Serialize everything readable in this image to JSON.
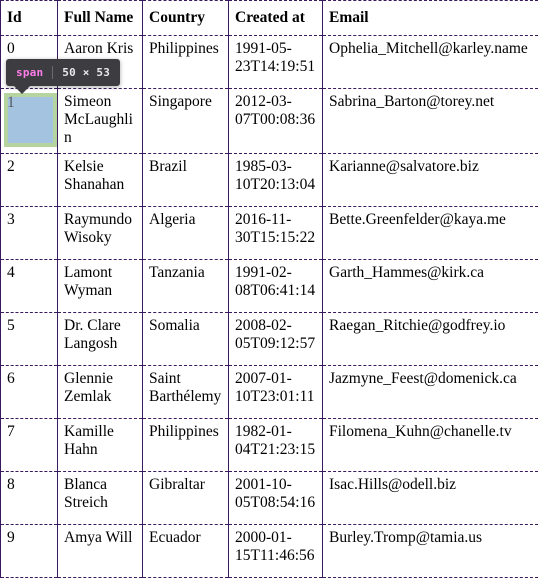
{
  "table": {
    "columns": [
      "Id",
      "Full Name",
      "Country",
      "Created at",
      "Email"
    ],
    "rows": [
      {
        "id": "0",
        "full_name": "Aaron Kris",
        "country": "Philippines",
        "created_at": "1991-05-23T14:19:51",
        "email": "Ophelia_Mitchell@karley.name"
      },
      {
        "id": "1",
        "full_name": "Simeon McLaughlin",
        "country": "Singapore",
        "created_at": "2012-03-07T00:08:36",
        "email": "Sabrina_Barton@torey.net"
      },
      {
        "id": "2",
        "full_name": "Kelsie Shanahan",
        "country": "Brazil",
        "created_at": "1985-03-10T20:13:04",
        "email": "Karianne@salvatore.biz"
      },
      {
        "id": "3",
        "full_name": "Raymundo Wisoky",
        "country": "Algeria",
        "created_at": "2016-11-30T15:15:22",
        "email": "Bette.Greenfelder@kaya.me"
      },
      {
        "id": "4",
        "full_name": "Lamont Wyman",
        "country": "Tanzania",
        "created_at": "1991-02-08T06:41:14",
        "email": "Garth_Hammes@kirk.ca"
      },
      {
        "id": "5",
        "full_name": "Dr. Clare Langosh",
        "country": "Somalia",
        "created_at": "2008-02-05T09:12:57",
        "email": "Raegan_Ritchie@godfrey.io"
      },
      {
        "id": "6",
        "full_name": "Glennie Zemlak",
        "country": "Saint Barthélemy",
        "created_at": "2007-01-10T23:01:11",
        "email": "Jazmyne_Feest@domenick.ca"
      },
      {
        "id": "7",
        "full_name": "Kamille Hahn",
        "country": "Philippines",
        "created_at": "1982-01-04T21:23:15",
        "email": "Filomena_Kuhn@chanelle.tv"
      },
      {
        "id": "8",
        "full_name": "Blanca Streich",
        "country": "Gibraltar",
        "created_at": "2001-10-05T08:54:16",
        "email": "Isac.Hills@odell.biz"
      },
      {
        "id": "9",
        "full_name": "Amya Will",
        "country": "Ecuador",
        "created_at": "2000-01-15T11:46:56",
        "email": "Burley.Tromp@tamia.us"
      }
    ]
  },
  "inspector": {
    "tag_name": "span",
    "dimensions": "50 × 53",
    "highlighted_text": "1",
    "colors": {
      "content_box": "#a3c3e0",
      "padding_box": "#b5d4a0",
      "tooltip_background": "#3c3c41",
      "tooltip_tag_color": "#ff7de9",
      "tooltip_dims_color": "#e8e8ea",
      "table_border": "#3a1a5e"
    }
  }
}
